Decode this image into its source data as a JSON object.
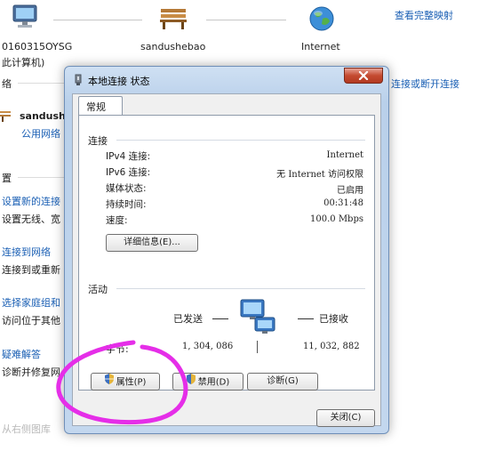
{
  "background": {
    "computer_name": "0160315OYSG",
    "computer_sub": "此计算机)",
    "home_name": "sandushebao",
    "internet_label": "Internet",
    "view_full_map": "查看完整映射",
    "network_prefix": "络",
    "connect_disconnect": "连接或断开连接",
    "network_name": "sandush",
    "network_type": "公用网络",
    "settings_heading": "置",
    "link_setup_new": "设置新的连接",
    "text_setup_wireless": "设置无线、宽",
    "link_connect_to": "连接到网络",
    "text_connect_or": "连接到或重新",
    "link_homegroup": "选择家庭组和",
    "text_homegroup": "访问位于其他",
    "link_troubleshoot": "疑难解答",
    "text_diagnose": "诊断并修复网",
    "watermark": "从右侧图库"
  },
  "dialog": {
    "title": "本地连接 状态",
    "tab_general": "常规",
    "section_connection": "连接",
    "rows": [
      {
        "label": "IPv4 连接:",
        "value": "Internet"
      },
      {
        "label": "IPv6 连接:",
        "value": "无 Internet 访问权限"
      },
      {
        "label": "媒体状态:",
        "value": "已启用"
      },
      {
        "label": "持续时间:",
        "value": "00:31:48"
      },
      {
        "label": "速度:",
        "value": "100.0 Mbps"
      }
    ],
    "details_button": "详细信息(E)...",
    "section_activity": "活动",
    "sent_label": "已发送",
    "received_label": "已接收",
    "bytes_label": "字节:",
    "bytes_sent": "1, 304, 086",
    "bytes_received": "11, 032, 882",
    "properties_button": "属性(P)",
    "disable_button": "禁用(D)",
    "diagnose_button": "诊断(G)",
    "close_button": "关闭(C)"
  },
  "colors": {
    "link": "#1a5fb4",
    "annotation": "#e52ee8",
    "close_red": "#c44a30"
  }
}
